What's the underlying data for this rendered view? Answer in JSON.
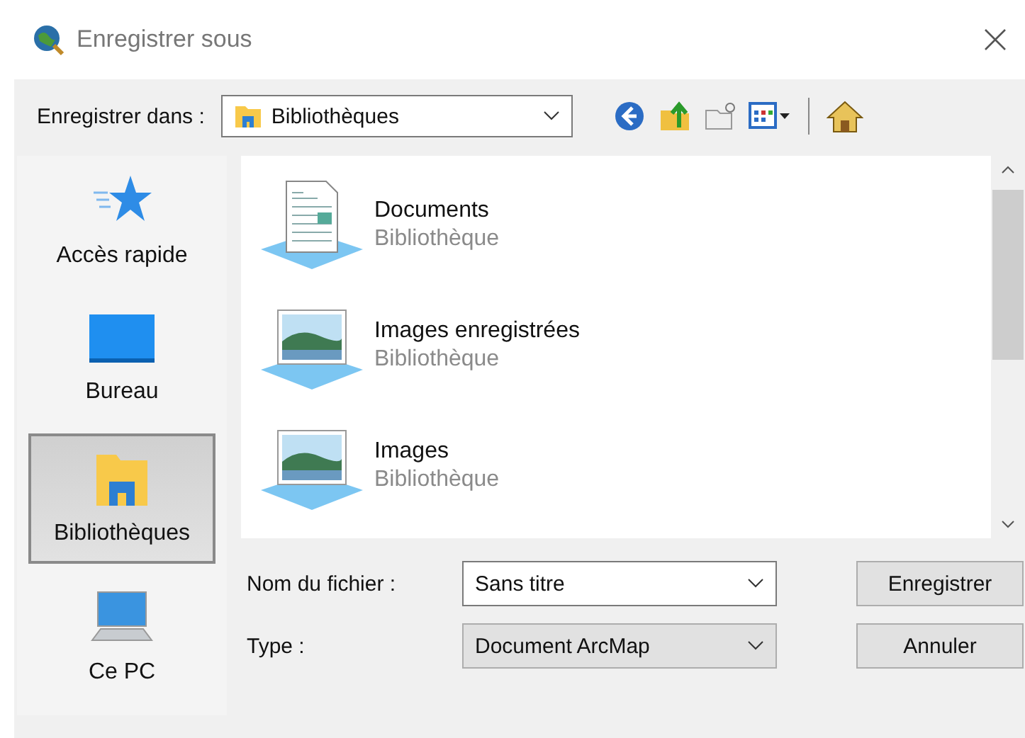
{
  "window": {
    "title": "Enregistrer sous"
  },
  "location": {
    "label": "Enregistrer dans :",
    "value": "Bibliothèques"
  },
  "places": [
    {
      "label": "Accès rapide",
      "kind": "star",
      "selected": false
    },
    {
      "label": "Bureau",
      "kind": "desktop",
      "selected": false
    },
    {
      "label": "Bibliothèques",
      "kind": "library",
      "selected": true
    },
    {
      "label": "Ce PC",
      "kind": "computer",
      "selected": false
    }
  ],
  "files": [
    {
      "name": "Documents",
      "type": "Bibliothèque",
      "kind": "document"
    },
    {
      "name": "Images enregistrées",
      "type": "Bibliothèque",
      "kind": "picture"
    },
    {
      "name": "Images",
      "type": "Bibliothèque",
      "kind": "picture"
    }
  ],
  "filename": {
    "label": "Nom du fichier :",
    "value": "Sans titre"
  },
  "filetype": {
    "label": "Type :",
    "value": "Document ArcMap"
  },
  "buttons": [
    "Enregistrer",
    "Annuler"
  ]
}
